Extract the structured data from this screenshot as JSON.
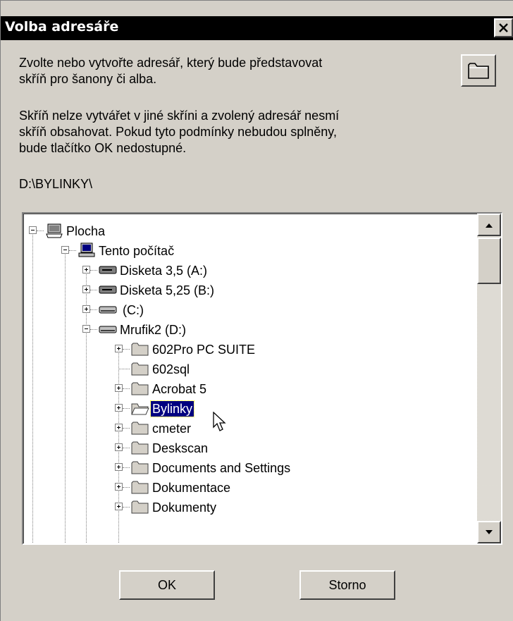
{
  "window": {
    "title": "Volba adresáře",
    "close_label": "×"
  },
  "description": {
    "line1": "Zvolte nebo vytvořte adresář, který bude představovat",
    "line2": "skříň pro šanony či alba.",
    "line3": "Skříň nelze vytvářet v jiné skříni a zvolený adresář nesmí",
    "line4": "skříň obsahovat. Pokud tyto podmínky nebudou splněny,",
    "line5": "bude tlačítko OK nedostupné."
  },
  "current_path": "D:\\BYLINKY\\",
  "new_folder_icon": "folder-icon",
  "tree": {
    "items": [
      {
        "label": "Plocha",
        "icon": "desktop-icon",
        "expanded": true
      },
      {
        "label": "Tento počítač",
        "icon": "computer-icon",
        "expanded": true
      },
      {
        "label": "Disketa 3,5 (A:)",
        "icon": "floppy-drive-icon",
        "expanded": false
      },
      {
        "label": "Disketa 5,25 (B:)",
        "icon": "floppy-drive-icon",
        "expanded": false
      },
      {
        "label": "(C:)",
        "icon": "hard-drive-icon",
        "expanded": false
      },
      {
        "label": "Mrufik2 (D:)",
        "icon": "hard-drive-icon",
        "expanded": true
      },
      {
        "label": "602Pro PC SUITE",
        "icon": "folder-icon",
        "expanded": false
      },
      {
        "label": "602sql",
        "icon": "folder-icon",
        "expanded": null
      },
      {
        "label": "Acrobat 5",
        "icon": "folder-icon",
        "expanded": false
      },
      {
        "label": "Bylinky",
        "icon": "open-folder-icon",
        "expanded": false,
        "selected": true
      },
      {
        "label": "cmeter",
        "icon": "folder-icon",
        "expanded": false
      },
      {
        "label": "Deskscan",
        "icon": "folder-icon",
        "expanded": false
      },
      {
        "label": "Documents and Settings",
        "icon": "folder-icon",
        "expanded": false
      },
      {
        "label": "Dokumentace",
        "icon": "folder-icon",
        "expanded": false
      },
      {
        "label": "Dokumenty",
        "icon": "folder-icon",
        "expanded": false
      }
    ]
  },
  "buttons": {
    "ok": "OK",
    "cancel": "Storno"
  },
  "colors": {
    "dialog_bg": "#d4d0c8",
    "titlebar_bg": "#000000",
    "selection_bg": "#000080"
  }
}
